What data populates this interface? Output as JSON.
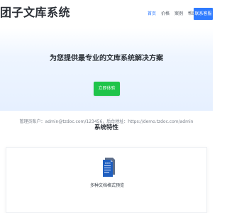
{
  "header": {
    "brand": "团子文库系统",
    "nav": [
      {
        "label": "首页",
        "active": true
      },
      {
        "label": "价格",
        "active": false
      },
      {
        "label": "案例",
        "active": false
      },
      {
        "label": "帮助",
        "active": false
      }
    ],
    "contact_label": "联系客服",
    "accent_color": "#2f7bff"
  },
  "hero": {
    "title": "为您提供最专业的文库系统解决方案",
    "cta_label": "立即体验",
    "cta_color": "#1fc44a",
    "info_text": "管理员账户：admin@tzdoc.com/123456，后台地址：https://demo.tzdoc.com/admin"
  },
  "features": {
    "title": "系统特性",
    "items": [
      {
        "label": "多种文档格式预览",
        "icon": "doc-icon",
        "icon_text": "DOC"
      }
    ]
  }
}
